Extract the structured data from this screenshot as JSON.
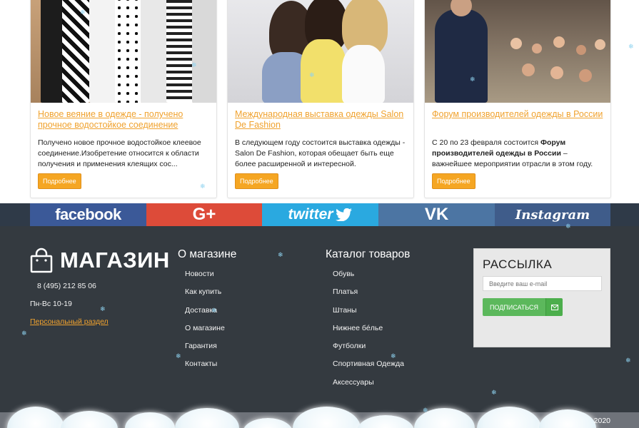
{
  "news": [
    {
      "title": "Новое веяние в одежде - получено прочное водостойкое соединение",
      "text_plain": "Получено новое прочное водостойкое клеевое соединение.Изобретение относится к области получения и применения клеящих сос...",
      "button": "Подробнее"
    },
    {
      "title": "Международная выставка одежды Salon De Fashion",
      "text_plain": "В следующем году состоится выставка одежды - Salon De Fashion, которая обещает быть еще более расширенной и интересной.",
      "button": "Подробнее"
    },
    {
      "title": "Форум производителей одежды в России",
      "text_pre": "С 20 по 23 февраля состоится ",
      "text_bold": "Форум производителей одежды в России",
      "text_post": " – важнейшее мероприятии отрасли в этом году.",
      "button": "Подробнее"
    }
  ],
  "social": {
    "facebook": "facebook",
    "googleplus": "G+",
    "twitter": "twitter",
    "vk": "VK",
    "instagram": "Instagram"
  },
  "footer": {
    "logo": "МАГАЗИН",
    "phone": "8 (495) 212 85 06",
    "hours": "Пн-Вс 10-19",
    "personal": "Персональный раздел",
    "about_title": "О магазине",
    "about_links": [
      "Новости",
      "Как купить",
      "Доставка",
      "О магазине",
      "Гарантия",
      "Контакты"
    ],
    "catalog_title": "Каталог товаров",
    "catalog_links": [
      "Обувь",
      "Платья",
      "Штаны",
      "Нижнее бéлье",
      "Футболки",
      "Спортивная Одежда",
      "Аксессуары"
    ],
    "newsletter_title": "РАССЫЛКА",
    "email_placeholder": "Введите ваш e-mail",
    "subscribe_button": "ПОДПИСАТЬСЯ",
    "year": "2020"
  },
  "colors": {
    "accent": "#f0a22e",
    "footer_bg": "#343a40",
    "facebook": "#3b5998",
    "googleplus": "#dd4b39",
    "twitter": "#2aa9e0",
    "vk": "#4c75a3",
    "instagram": "#3f5c8a",
    "subscribe": "#5cb85c"
  },
  "icons": [
    "shopping-bag-icon",
    "envelope-icon",
    "snowflake-icon",
    "twitter-bird-icon"
  ]
}
